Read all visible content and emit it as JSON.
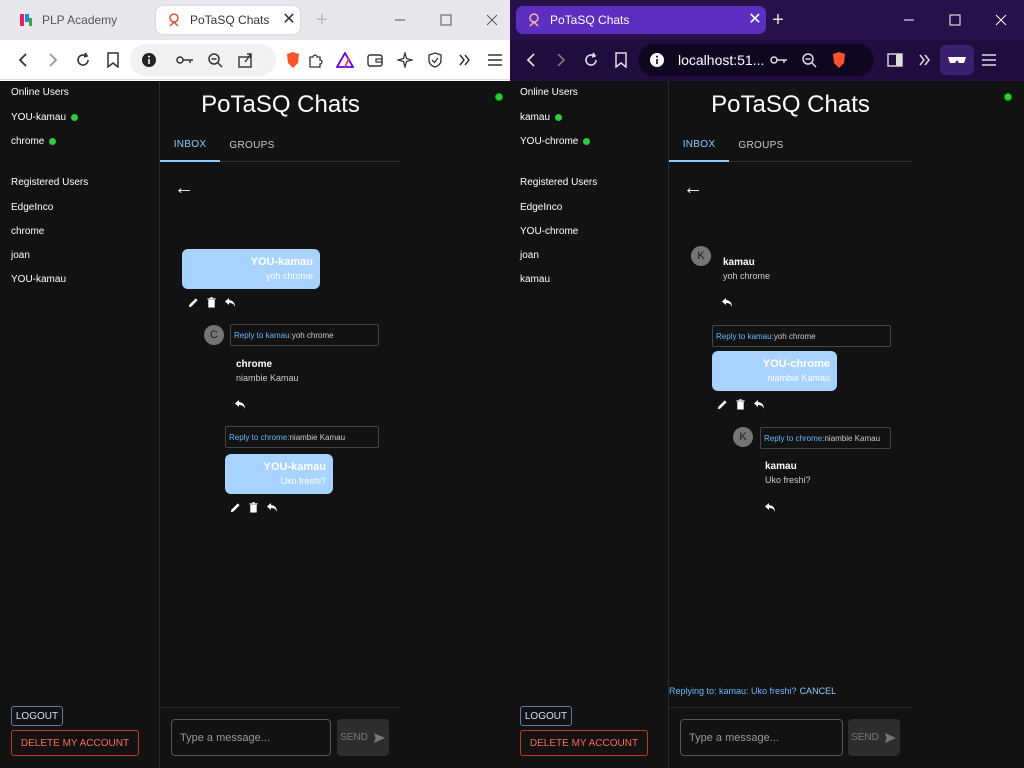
{
  "left": {
    "tabs": [
      {
        "title": "PLP Academy",
        "close": ""
      },
      {
        "title": "PoTaSQ Chats",
        "close": "✕"
      }
    ],
    "new_tab": "+",
    "window_controls": [
      "—",
      "☐",
      "✕"
    ],
    "app": {
      "online_users_title": "Online Users",
      "online_users": [
        "YOU-kamau",
        "chrome"
      ],
      "registered_users_title": "Registered Users",
      "registered_users": [
        "EdgeInco",
        "chrome",
        "joan",
        "YOU-kamau"
      ],
      "logout_label": "LOGOUT",
      "delete_label": "DELETE MY ACCOUNT",
      "page_title": "PoTaSQ Chats",
      "tabs": [
        "INBOX",
        "GROUPS"
      ],
      "back": "←",
      "messages": [
        {
          "sender": "YOU-kamau",
          "text": "yoh chrome"
        },
        {
          "reply_prefix": "Reply to kamau:",
          "reply_text": "yoh chrome",
          "avatar": "C",
          "sender": "chrome",
          "text": "niambie Kamau"
        },
        {
          "reply_prefix": "Reply to chrome:",
          "reply_text": "niambie Kamau",
          "sender": "YOU-kamau",
          "text": "Uko freshi?"
        }
      ],
      "input_placeholder": "Type a message...",
      "send_label": "SEND"
    }
  },
  "right": {
    "tabs": [
      {
        "title": "PoTaSQ Chats",
        "close": "✕"
      }
    ],
    "new_tab": "+",
    "window_controls": [
      "—",
      "☐",
      "✕"
    ],
    "url": "localhost:51...",
    "app": {
      "online_users_title": "Online Users",
      "online_users": [
        "kamau",
        "YOU-chrome"
      ],
      "registered_users_title": "Registered Users",
      "registered_users": [
        "EdgeInco",
        "YOU-chrome",
        "joan",
        "kamau"
      ],
      "logout_label": "LOGOUT",
      "delete_label": "DELETE MY ACCOUNT",
      "page_title": "PoTaSQ Chats",
      "tabs": [
        "INBOX",
        "GROUPS"
      ],
      "back": "←",
      "messages": [
        {
          "avatar": "K",
          "sender": "kamau",
          "text": "yoh chrome"
        },
        {
          "reply_prefix": "Reply to kamau:",
          "reply_text": "yoh chrome",
          "sender": "YOU-chrome",
          "text": "niambie Kamau"
        },
        {
          "reply_prefix": "Reply to chrome:",
          "reply_text": "niambie Kamau",
          "avatar": "K",
          "sender": "kamau",
          "text": "Uko freshi?"
        }
      ],
      "replying_prefix": "Replying to: kamau: Uko freshi?",
      "cancel_label": "CANCEL",
      "input_placeholder": "Type a message...",
      "send_label": "SEND"
    }
  },
  "colors": {
    "bubble": "#a9d3ff",
    "online": "#2ecc40",
    "accent": "#90caf9",
    "danger": "#c0392b"
  }
}
